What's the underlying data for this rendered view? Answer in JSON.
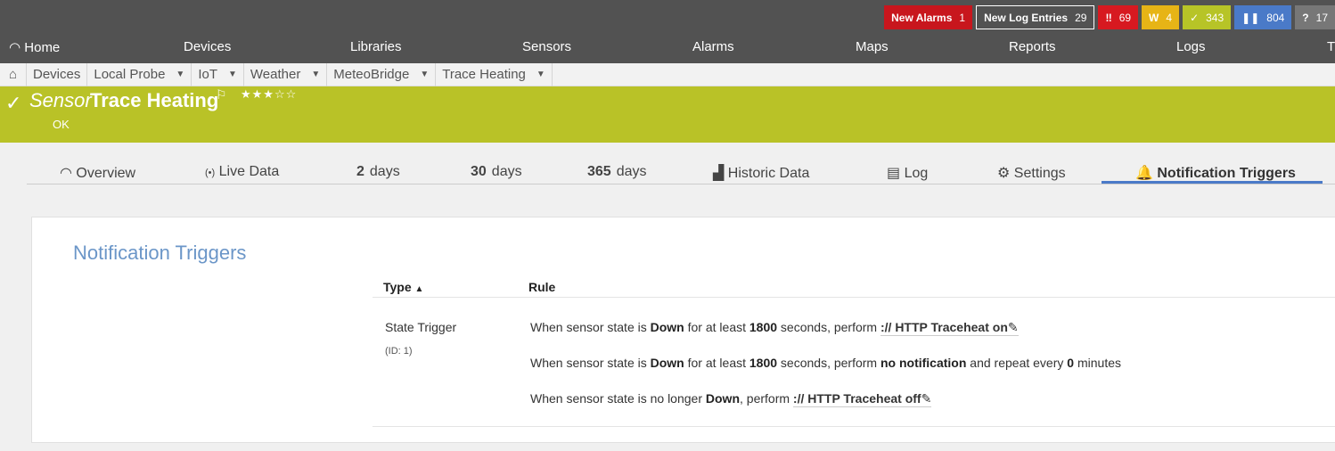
{
  "badges": {
    "new_alarms_label": "New Alarms",
    "new_alarms_count": "1",
    "new_log_label": "New Log Entries",
    "new_log_count": "29",
    "down_icon": "‼",
    "down_count": "69",
    "warning_icon": "W",
    "warning_count": "4",
    "up_icon": "✓",
    "up_count": "343",
    "paused_icon": "❚❚",
    "paused_count": "804",
    "unknown_icon": "?",
    "unknown_count": "17"
  },
  "nav": {
    "home": "Home",
    "devices": "Devices",
    "libraries": "Libraries",
    "sensors": "Sensors",
    "alarms": "Alarms",
    "maps": "Maps",
    "reports": "Reports",
    "logs": "Logs",
    "tickets": "T"
  },
  "breadcrumbs": {
    "devices": "Devices",
    "local_probe": "Local Probe",
    "iot": "IoT",
    "weather": "Weather",
    "meteobridge": "MeteoBridge",
    "trace_heating": "Trace Heating",
    "caret": "▼"
  },
  "header": {
    "kind": "Sensor",
    "name": "Trace Heating",
    "status": "OK",
    "stars": "★★★☆☆",
    "flag_icon": "⚐",
    "check_icon": "✓"
  },
  "tabs": {
    "overview": "Overview",
    "live_data": "Live Data",
    "d2_num": "2",
    "d2_unit": "days",
    "d30_num": "30",
    "d30_unit": "days",
    "d365_num": "365",
    "d365_unit": "days",
    "historic": "Historic Data",
    "log": "Log",
    "settings": "Settings",
    "notification_triggers": "Notification Triggers"
  },
  "panel": {
    "title": "Notification Triggers",
    "col_type": "Type",
    "col_rule": "Rule",
    "trigger_type": "State Trigger",
    "trigger_id": "(ID: 1)",
    "rule1": {
      "a": "When sensor state is ",
      "state": "Down",
      "b": " for at least ",
      "secs": "1800",
      "c": " seconds, perform ",
      "action": ":// HTTP Traceheat on"
    },
    "rule2": {
      "a": "When sensor state is ",
      "state": "Down",
      "b": " for at least ",
      "secs": "1800",
      "c": " seconds, perform ",
      "action": "no notification",
      "d": " and repeat every ",
      "mins": "0",
      "e": " minutes"
    },
    "rule3": {
      "a": "When sensor state is no longer ",
      "state": "Down",
      "b": ", perform ",
      "action": ":// HTTP Traceheat off"
    }
  }
}
